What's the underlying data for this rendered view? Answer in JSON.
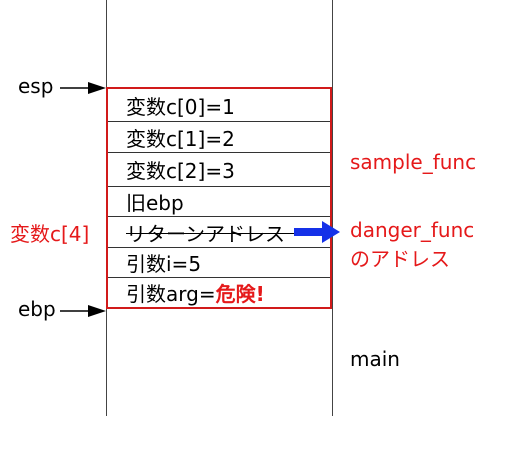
{
  "pointers": {
    "esp": "esp",
    "ebp": "ebp"
  },
  "stack_rows": [
    "変数c[0]=1",
    "変数c[1]=2",
    "変数c[2]=3",
    "旧ebp",
    "リターンアドレス",
    "引数i=5"
  ],
  "last_row": {
    "prefix": "引数arg=",
    "danger": "危険!"
  },
  "side_labels": {
    "overflow": "変数c[4]",
    "sample_func": "sample_func",
    "danger_func_line1": "danger_func",
    "danger_func_line2": "のアドレス",
    "main": "main"
  },
  "colors": {
    "frame": "#d11a1a",
    "red_text": "#e5191a",
    "arrow_blue": "#1531e8"
  }
}
